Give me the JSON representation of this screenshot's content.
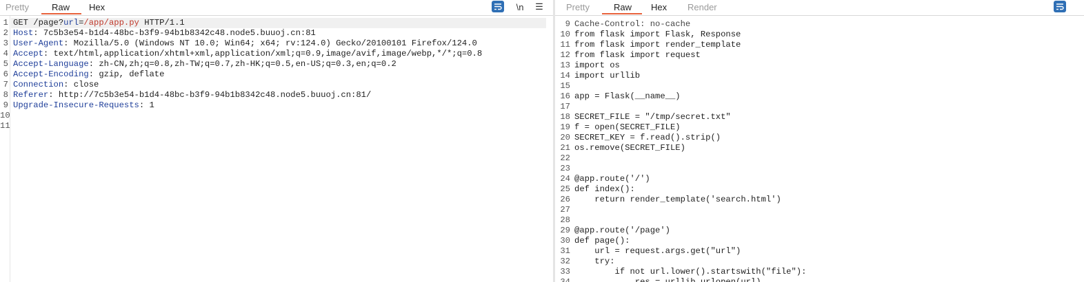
{
  "request": {
    "tabs": [
      "Pretty",
      "Raw",
      "Hex"
    ],
    "active_tab": "Raw",
    "newline_toggle": "\\n",
    "menu_glyph": "☰",
    "lines": [
      {
        "n": "1",
        "parts": [
          {
            "t": "GET /page?"
          },
          {
            "t": "url",
            "c": "k"
          },
          {
            "t": "="
          },
          {
            "t": "/app/app.py",
            "c": "r"
          },
          {
            "t": " HTTP/1.1"
          }
        ]
      },
      {
        "n": "2",
        "parts": [
          {
            "t": "Host",
            "c": "k"
          },
          {
            "t": ": 7c5b3e54-b1d4-48bc-b3f9-94b1b8342c48.node5.buuoj.cn:81"
          }
        ]
      },
      {
        "n": "3",
        "parts": [
          {
            "t": "User-Agent",
            "c": "k"
          },
          {
            "t": ": Mozilla/5.0 (Windows NT 10.0; Win64; x64; rv:124.0) Gecko/20100101 Firefox/124.0"
          }
        ]
      },
      {
        "n": "4",
        "parts": [
          {
            "t": "Accept",
            "c": "k"
          },
          {
            "t": ": text/html,application/xhtml+xml,application/xml;q=0.9,image/avif,image/webp,*/*;q=0.8"
          }
        ]
      },
      {
        "n": "5",
        "parts": [
          {
            "t": "Accept-Language",
            "c": "k"
          },
          {
            "t": ": zh-CN,zh;q=0.8,zh-TW;q=0.7,zh-HK;q=0.5,en-US;q=0.3,en;q=0.2"
          }
        ]
      },
      {
        "n": "6",
        "parts": [
          {
            "t": "Accept-Encoding",
            "c": "k"
          },
          {
            "t": ": gzip, deflate"
          }
        ]
      },
      {
        "n": "7",
        "parts": [
          {
            "t": "Connection",
            "c": "k"
          },
          {
            "t": ": close"
          }
        ]
      },
      {
        "n": "8",
        "parts": [
          {
            "t": "Referer",
            "c": "k"
          },
          {
            "t": ": http://7c5b3e54-b1d4-48bc-b3f9-94b1b8342c48.node5.buuoj.cn:81/"
          }
        ]
      },
      {
        "n": "9",
        "parts": [
          {
            "t": "Upgrade-Insecure-Requests",
            "c": "k"
          },
          {
            "t": ": 1"
          }
        ]
      },
      {
        "n": "10",
        "parts": []
      },
      {
        "n": "11",
        "parts": []
      }
    ]
  },
  "response": {
    "tabs": [
      "Pretty",
      "Raw",
      "Hex",
      "Render"
    ],
    "active_tab": "Raw",
    "partial_top_line": "Cache-Control: no-cache",
    "lines": [
      {
        "n": "9",
        "parts": []
      },
      {
        "n": "10",
        "parts": [
          {
            "t": "from flask import Flask, Response"
          }
        ]
      },
      {
        "n": "11",
        "parts": [
          {
            "t": "from flask import render_template"
          }
        ]
      },
      {
        "n": "12",
        "parts": [
          {
            "t": "from flask import request"
          }
        ]
      },
      {
        "n": "13",
        "parts": [
          {
            "t": "import os"
          }
        ]
      },
      {
        "n": "14",
        "parts": [
          {
            "t": "import urllib"
          }
        ]
      },
      {
        "n": "15",
        "parts": []
      },
      {
        "n": "16",
        "parts": [
          {
            "t": "app = Flask(__name__)"
          }
        ]
      },
      {
        "n": "17",
        "parts": []
      },
      {
        "n": "18",
        "parts": [
          {
            "t": "SECRET_FILE = \"/tmp/secret.txt\""
          }
        ]
      },
      {
        "n": "19",
        "parts": [
          {
            "t": "f = open(SECRET_FILE)"
          }
        ]
      },
      {
        "n": "20",
        "parts": [
          {
            "t": "SECRET_KEY = f.read().strip()"
          }
        ]
      },
      {
        "n": "21",
        "parts": [
          {
            "t": "os.remove(SECRET_FILE)"
          }
        ]
      },
      {
        "n": "22",
        "parts": []
      },
      {
        "n": "23",
        "parts": []
      },
      {
        "n": "24",
        "parts": [
          {
            "t": "@app.route('/')"
          }
        ]
      },
      {
        "n": "25",
        "parts": [
          {
            "t": "def index():"
          }
        ]
      },
      {
        "n": "26",
        "parts": [
          {
            "t": "    return render_template('search.html')"
          }
        ]
      },
      {
        "n": "27",
        "parts": []
      },
      {
        "n": "28",
        "parts": []
      },
      {
        "n": "29",
        "parts": [
          {
            "t": "@app.route('/page')"
          }
        ]
      },
      {
        "n": "30",
        "parts": [
          {
            "t": "def page():"
          }
        ]
      },
      {
        "n": "31",
        "parts": [
          {
            "t": "    url = request.args.get(\"url\")"
          }
        ]
      },
      {
        "n": "32",
        "parts": [
          {
            "t": "    try:"
          }
        ]
      },
      {
        "n": "33",
        "parts": [
          {
            "t": "        if not url.lower().startswith(\"file\"):"
          }
        ]
      },
      {
        "n": "34",
        "parts": [
          {
            "t": "            res = urllib.urlopen(url)"
          }
        ]
      }
    ]
  }
}
